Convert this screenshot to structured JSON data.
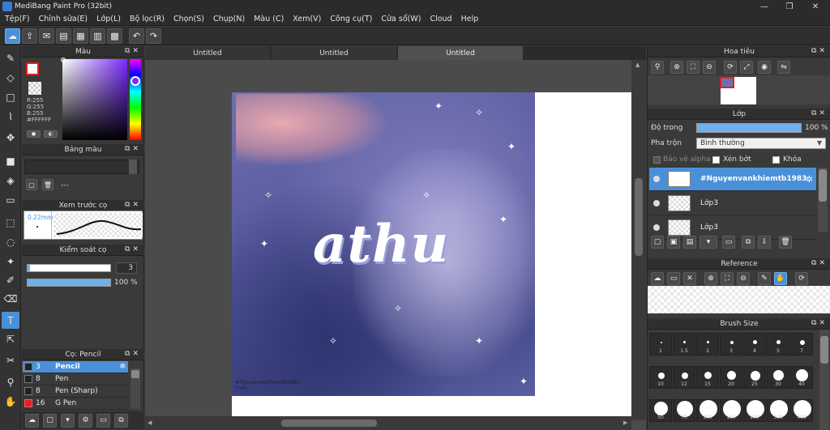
{
  "window": {
    "title": "MediBang Paint Pro (32bit)",
    "controls": [
      "—",
      "❐",
      "✕"
    ]
  },
  "menu": [
    "Tệp(F)",
    "Chỉnh sửa(E)",
    "Lớp(L)",
    "Bộ lọc(R)",
    "Chọn(S)",
    "Chụp(N)",
    "Màu (C)",
    "Xem(V)",
    "Công cụ(T)",
    "Cửa sổ(W)",
    "Cloud",
    "Help"
  ],
  "color_panel": {
    "title": "Màu",
    "fg_color": "#FFFFFF",
    "rgb": "R:255\nG:255\nB:255\n#FFFFFF"
  },
  "palette_panel": {
    "title": "Bảng màu",
    "dash": "---"
  },
  "preview_panel": {
    "title": "Xem trước cọ",
    "size": "0.22mm"
  },
  "control_panel": {
    "title": "Kiểm soát cọ",
    "size_value": "3",
    "opacity_value": "100 %",
    "size_fraction": 0.03,
    "opacity_fraction": 1.0
  },
  "brush_panel": {
    "title": "Cọ: Pencil",
    "brushes": [
      {
        "size": "3",
        "name": "Pencil",
        "color": "#222222",
        "selected": true
      },
      {
        "size": "8",
        "name": "Pen",
        "color": "#222222",
        "selected": false
      },
      {
        "size": "8",
        "name": "Pen (Sharp)",
        "color": "#222222",
        "selected": false
      },
      {
        "size": "16",
        "name": "G Pen",
        "color": "#e02020",
        "selected": false
      }
    ]
  },
  "tabs": [
    {
      "label": "Untitled",
      "active": false
    },
    {
      "label": "Untitled",
      "active": false
    },
    {
      "label": "Untitled",
      "active": true
    }
  ],
  "canvas": {
    "artwork_text": "athu",
    "watermark": "#Tlguyenvankhiemtb1983\nFrom"
  },
  "navigator": {
    "title": "Hoa tiêu"
  },
  "layers": {
    "title": "Lớp",
    "opacity_label": "Độ trong",
    "opacity_value": "100 %",
    "opacity_fraction": 1.0,
    "blend_label": "Pha trộn",
    "blend_value": "Bình thường",
    "protect_alpha": "Bảo vệ alpha",
    "clipping": "Xén bớt",
    "lock": "Khóa",
    "items": [
      {
        "name": "#Nguyenvankhiemtb1983",
        "selected": true
      },
      {
        "name": "Lớp3",
        "selected": false
      },
      {
        "name": "Lớp3",
        "selected": false
      }
    ]
  },
  "reference": {
    "title": "Reference"
  },
  "brush_size": {
    "title": "Brush Size",
    "sizes": [
      "1",
      "1.5",
      "2",
      "3",
      "4",
      "5",
      "7",
      "10",
      "12",
      "15",
      "20",
      "25",
      "30",
      "40",
      "50",
      "70",
      "100",
      "150",
      "200",
      "300",
      "400"
    ]
  },
  "accent_color": "#4a90d9"
}
